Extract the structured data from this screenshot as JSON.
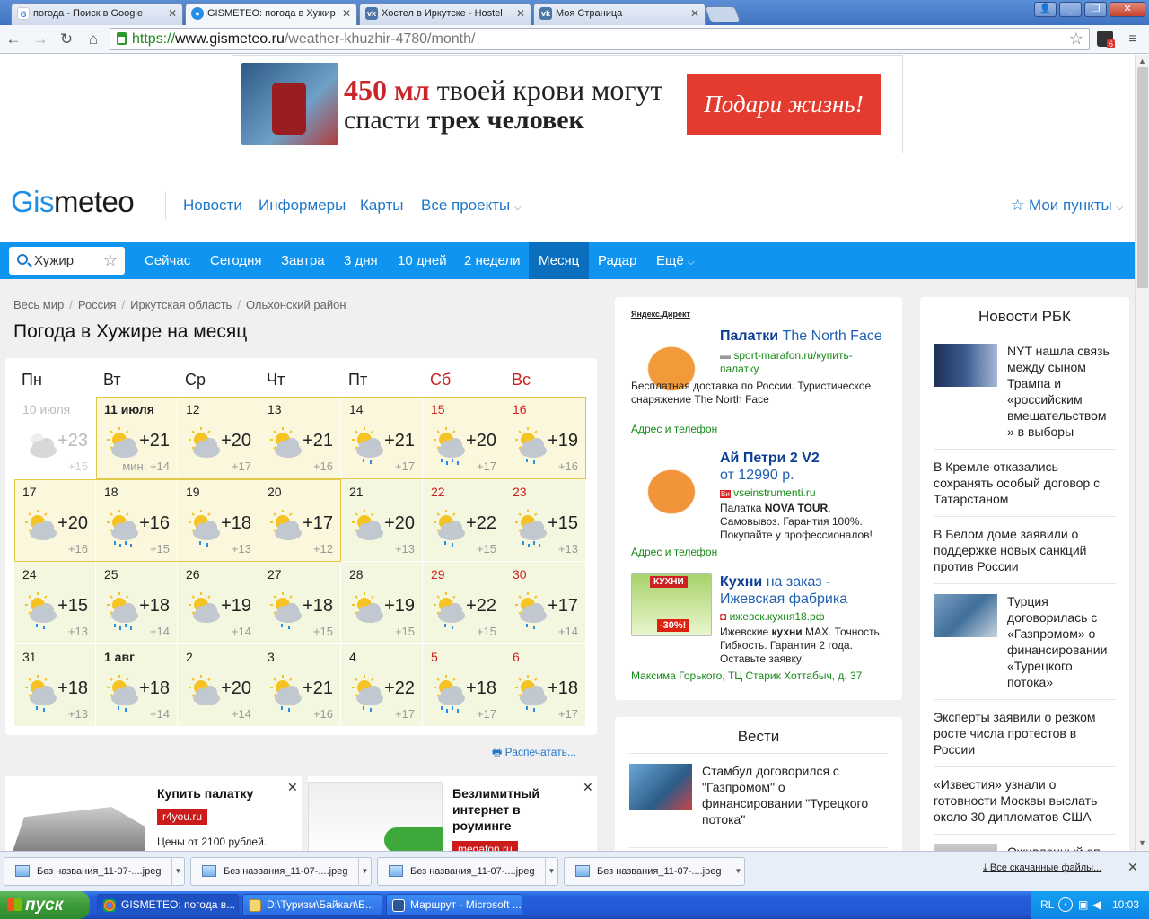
{
  "browser": {
    "tabs": [
      {
        "title": "погода - Поиск в Google",
        "icon": "google-icon"
      },
      {
        "title": "GISMETEO: погода в Хужир",
        "icon": "gismeteo-icon"
      },
      {
        "title": "Хостел в Иркутске - Hostel",
        "icon": "vk-icon"
      },
      {
        "title": "Моя Страница",
        "icon": "vk-icon"
      }
    ],
    "url_scheme": "https://",
    "url_host": "www.gismeteo.ru",
    "url_path": "/weather-khuzhir-4780/month/",
    "extension_badge": "6"
  },
  "banner": {
    "amount": "450 мл",
    "line1_rest": " твоей крови могут",
    "line2_start": "спасти ",
    "line2_bold": "трех человек",
    "cta": "Подари жизнь!"
  },
  "site": {
    "logo_a": "Gis",
    "logo_b": "meteo",
    "topnav": [
      "Новости",
      "Информеры",
      "Карты",
      "Все проекты"
    ],
    "my_points": "Мои пункты",
    "search_value": "Хужир",
    "nav": [
      "Сейчас",
      "Сегодня",
      "Завтра",
      "3 дня",
      "10 дней",
      "2 недели",
      "Месяц",
      "Радар",
      "Ещё"
    ],
    "active_nav": "Месяц",
    "breadcrumbs": [
      "Весь мир",
      "Россия",
      "Иркутская область",
      "Ольхонский район"
    ],
    "page_title": "Погода в Хужире на месяц",
    "print_label": "Распечатать..."
  },
  "calendar": {
    "weekdays": [
      "Пн",
      "Вт",
      "Ср",
      "Чт",
      "Пт",
      "Сб",
      "Вс"
    ],
    "weeks": [
      [
        {
          "d": "10 июля",
          "t": "+23",
          "n": "+15",
          "past": true,
          "icon": "cloudy"
        },
        {
          "d": "11 июля",
          "t": "+21",
          "n": "мин: +14",
          "icon": "sun-cloud",
          "bold": false
        },
        {
          "d": "12",
          "t": "+20",
          "n": "+17",
          "icon": "sun-cloud"
        },
        {
          "d": "13",
          "t": "+21",
          "n": "+16",
          "icon": "sun-cloud"
        },
        {
          "d": "14",
          "t": "+21",
          "n": "+17",
          "icon": "sun-cloud-rain"
        },
        {
          "d": "15",
          "t": "+20",
          "n": "+17",
          "icon": "sun-cloud-storm"
        },
        {
          "d": "16",
          "t": "+19",
          "n": "+16",
          "icon": "sun-cloud-rain"
        }
      ],
      [
        {
          "d": "17",
          "t": "+20",
          "n": "+16",
          "icon": "sun-cloud"
        },
        {
          "d": "18",
          "t": "+16",
          "n": "+15",
          "icon": "sun-cloud-storm"
        },
        {
          "d": "19",
          "t": "+18",
          "n": "+13",
          "icon": "sun-cloud-rain"
        },
        {
          "d": "20",
          "t": "+17",
          "n": "+12",
          "icon": "sun-cloud"
        },
        {
          "d": "21",
          "t": "+20",
          "n": "+13",
          "icon": "sun-cloud"
        },
        {
          "d": "22",
          "t": "+22",
          "n": "+15",
          "icon": "sun-cloud-rain"
        },
        {
          "d": "23",
          "t": "+15",
          "n": "+13",
          "icon": "sun-cloud-storm"
        }
      ],
      [
        {
          "d": "24",
          "t": "+15",
          "n": "+13",
          "icon": "sun-cloud-rain"
        },
        {
          "d": "25",
          "t": "+18",
          "n": "+14",
          "icon": "sun-cloud-storm"
        },
        {
          "d": "26",
          "t": "+19",
          "n": "+14",
          "icon": "sun-cloud"
        },
        {
          "d": "27",
          "t": "+18",
          "n": "+15",
          "icon": "sun-cloud-rain"
        },
        {
          "d": "28",
          "t": "+19",
          "n": "+15",
          "icon": "sun-cloud"
        },
        {
          "d": "29",
          "t": "+22",
          "n": "+15",
          "icon": "sun-cloud-rain"
        },
        {
          "d": "30",
          "t": "+17",
          "n": "+14",
          "icon": "sun-cloud-rain"
        }
      ],
      [
        {
          "d": "31",
          "t": "+18",
          "n": "+13",
          "icon": "sun-cloud-rain"
        },
        {
          "d": "1 авг",
          "t": "+18",
          "n": "+14",
          "icon": "sun-cloud-rain",
          "bold": true
        },
        {
          "d": "2",
          "t": "+20",
          "n": "+14",
          "icon": "sun-cloud"
        },
        {
          "d": "3",
          "t": "+21",
          "n": "+16",
          "icon": "sun-cloud-rain"
        },
        {
          "d": "4",
          "t": "+22",
          "n": "+17",
          "icon": "sun-cloud-rain"
        },
        {
          "d": "5",
          "t": "+18",
          "n": "+17",
          "icon": "sun-cloud-storm"
        },
        {
          "d": "6",
          "t": "+18",
          "n": "+17",
          "icon": "sun-cloud-rain"
        }
      ]
    ]
  },
  "bottom_ads": [
    {
      "title": "Купить палатку",
      "url": "r4you.ru",
      "text": "Цены от 2100 рублей."
    },
    {
      "title": "Безлимитный интернет в роуминге",
      "url": "megafon.ru"
    }
  ],
  "yandex_direct": {
    "label": "Яндекс.Директ",
    "items": [
      {
        "title_a": "Палатки",
        "title_b": " The North Face",
        "url": "sport-marafon.ru/купить-палатку",
        "text": "Бесплатная доставка по России. Туристическое снаряжение The North Face",
        "addr": "Адрес и телефон"
      },
      {
        "title_a": "Ай Петри 2 V2",
        "title_b": "от 12990 р.",
        "url": "vseinstrumenti.ru",
        "text_a": "Палатка ",
        "text_bold": "NOVA TOUR",
        "text_b": ". Самовывоз. Гарантия 100%. Покупайте у профессионалов!",
        "addr": "Адрес и телефон"
      },
      {
        "title_a": "Кухни",
        "title_b": " на заказ - Ижевская фабрика",
        "url": "ижевск.кухня18.рф",
        "text_a": "Ижевские ",
        "text_bold": "кухни",
        "text_b": " MAX. Точность. Гибкость. Гарантия 2 года. Оставьте заявку!",
        "addr": "Максима Горького, ТЦ Старик Хоттабыч, д. 37",
        "img_text": "КУХНИ",
        "img_sale": "-30%!"
      }
    ]
  },
  "vesti": {
    "title": "Вести",
    "items": [
      "Стамбул договорился с \"Газпромом\" о финансировании \"Турецкого потока\""
    ]
  },
  "rbk": {
    "title": "Новости РБК",
    "items": [
      "NYT нашла связь между сыном Трампа и «российским вмешательством » в выборы",
      "В Кремле отказались сохранять особый договор с Татарстаном",
      "В Белом доме заявили о поддержке новых санкций против России",
      "Турция договорилась с «Газпромом» о финансировании «Турецкого потока»",
      "Эксперты заявили о резком росте числа протестов в России",
      "«Известия» узнали о готовности Москвы выслать около 30 дипломатов США",
      "Оживленный оп..."
    ]
  },
  "downloads": {
    "files": [
      "Без названия_11-07-....jpeg",
      "Без названия_11-07-....jpeg",
      "Без названия_11-07-....jpeg",
      "Без названия_11-07-....jpeg"
    ],
    "show_all": "Все скачанные файлы..."
  },
  "taskbar": {
    "start": "пуск",
    "tasks": [
      "GISMETEO: погода в...",
      "D:\\Туризм\\Байкал\\Б...",
      "Маршрут - Microsoft ..."
    ],
    "lang": "RL",
    "time": "10:03"
  }
}
